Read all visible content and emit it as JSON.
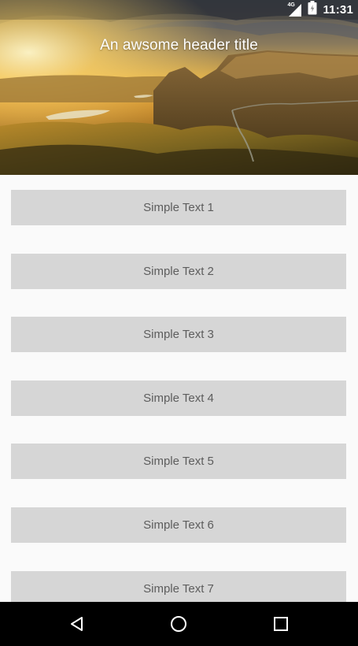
{
  "status_bar": {
    "network": "4G",
    "time": "11:31"
  },
  "header": {
    "title": "An awsome header title",
    "image": "landscape-photo"
  },
  "list": {
    "items": [
      {
        "label": "Simple Text 1"
      },
      {
        "label": "Simple Text 2"
      },
      {
        "label": "Simple Text 3"
      },
      {
        "label": "Simple Text 4"
      },
      {
        "label": "Simple Text 5"
      },
      {
        "label": "Simple Text 6"
      },
      {
        "label": "Simple Text 7"
      }
    ]
  },
  "nav_bar": {
    "buttons": [
      {
        "icon": "back-triangle-icon"
      },
      {
        "icon": "home-circle-icon"
      },
      {
        "icon": "recents-square-icon"
      }
    ]
  },
  "colors": {
    "background": "#fafafa",
    "item_background": "#d6d6d6",
    "item_text": "#5d5d5d",
    "nav_bar": "#000000"
  }
}
